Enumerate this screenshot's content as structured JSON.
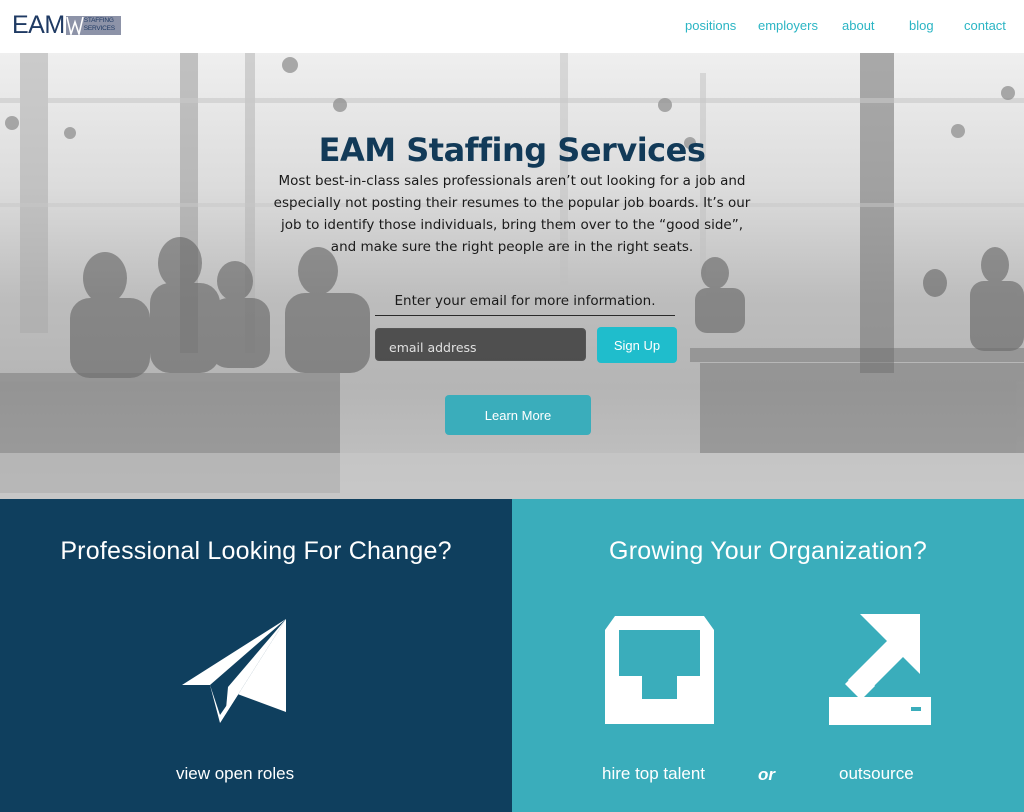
{
  "header": {
    "logo_main": "EAM",
    "logo_sub_line1": "STAFFING",
    "logo_sub_line2": "SERVICES",
    "nav": [
      {
        "label": "positions"
      },
      {
        "label": "employers"
      },
      {
        "label": "about"
      },
      {
        "label": "blog"
      },
      {
        "label": "contact"
      }
    ]
  },
  "hero": {
    "title": "EAM Staffing Services",
    "description": "Most best-in-class sales professionals aren’t out looking for a job and especially not posting their resumes to the popular job boards. It’s our job to identify those individuals, bring them over to the “good side”, and make sure the right people are in the right seats.",
    "email_prompt": "Enter your email for more information.",
    "email_placeholder": "email address",
    "signup_label": "Sign Up",
    "learn_more_label": "Learn More"
  },
  "panels": {
    "left": {
      "title": "Professional Looking For Change?",
      "icon": "paper-plane-icon",
      "link": "view open roles"
    },
    "right": {
      "title": "Growing Your Organization?",
      "hire_icon": "inbox-tray-icon",
      "hire_link": "hire top talent",
      "or_text": "or",
      "outsource_icon": "outbound-arrow-icon",
      "outsource_link": "outsource"
    }
  },
  "colors": {
    "nav_text": "#2bb5c4",
    "title_navy": "#123a58",
    "panel_left_bg": "#0f3f5e",
    "panel_right_bg": "#3aadbb",
    "signup_bg": "#1fbdcc",
    "learn_more_bg": "#3aadbb"
  }
}
